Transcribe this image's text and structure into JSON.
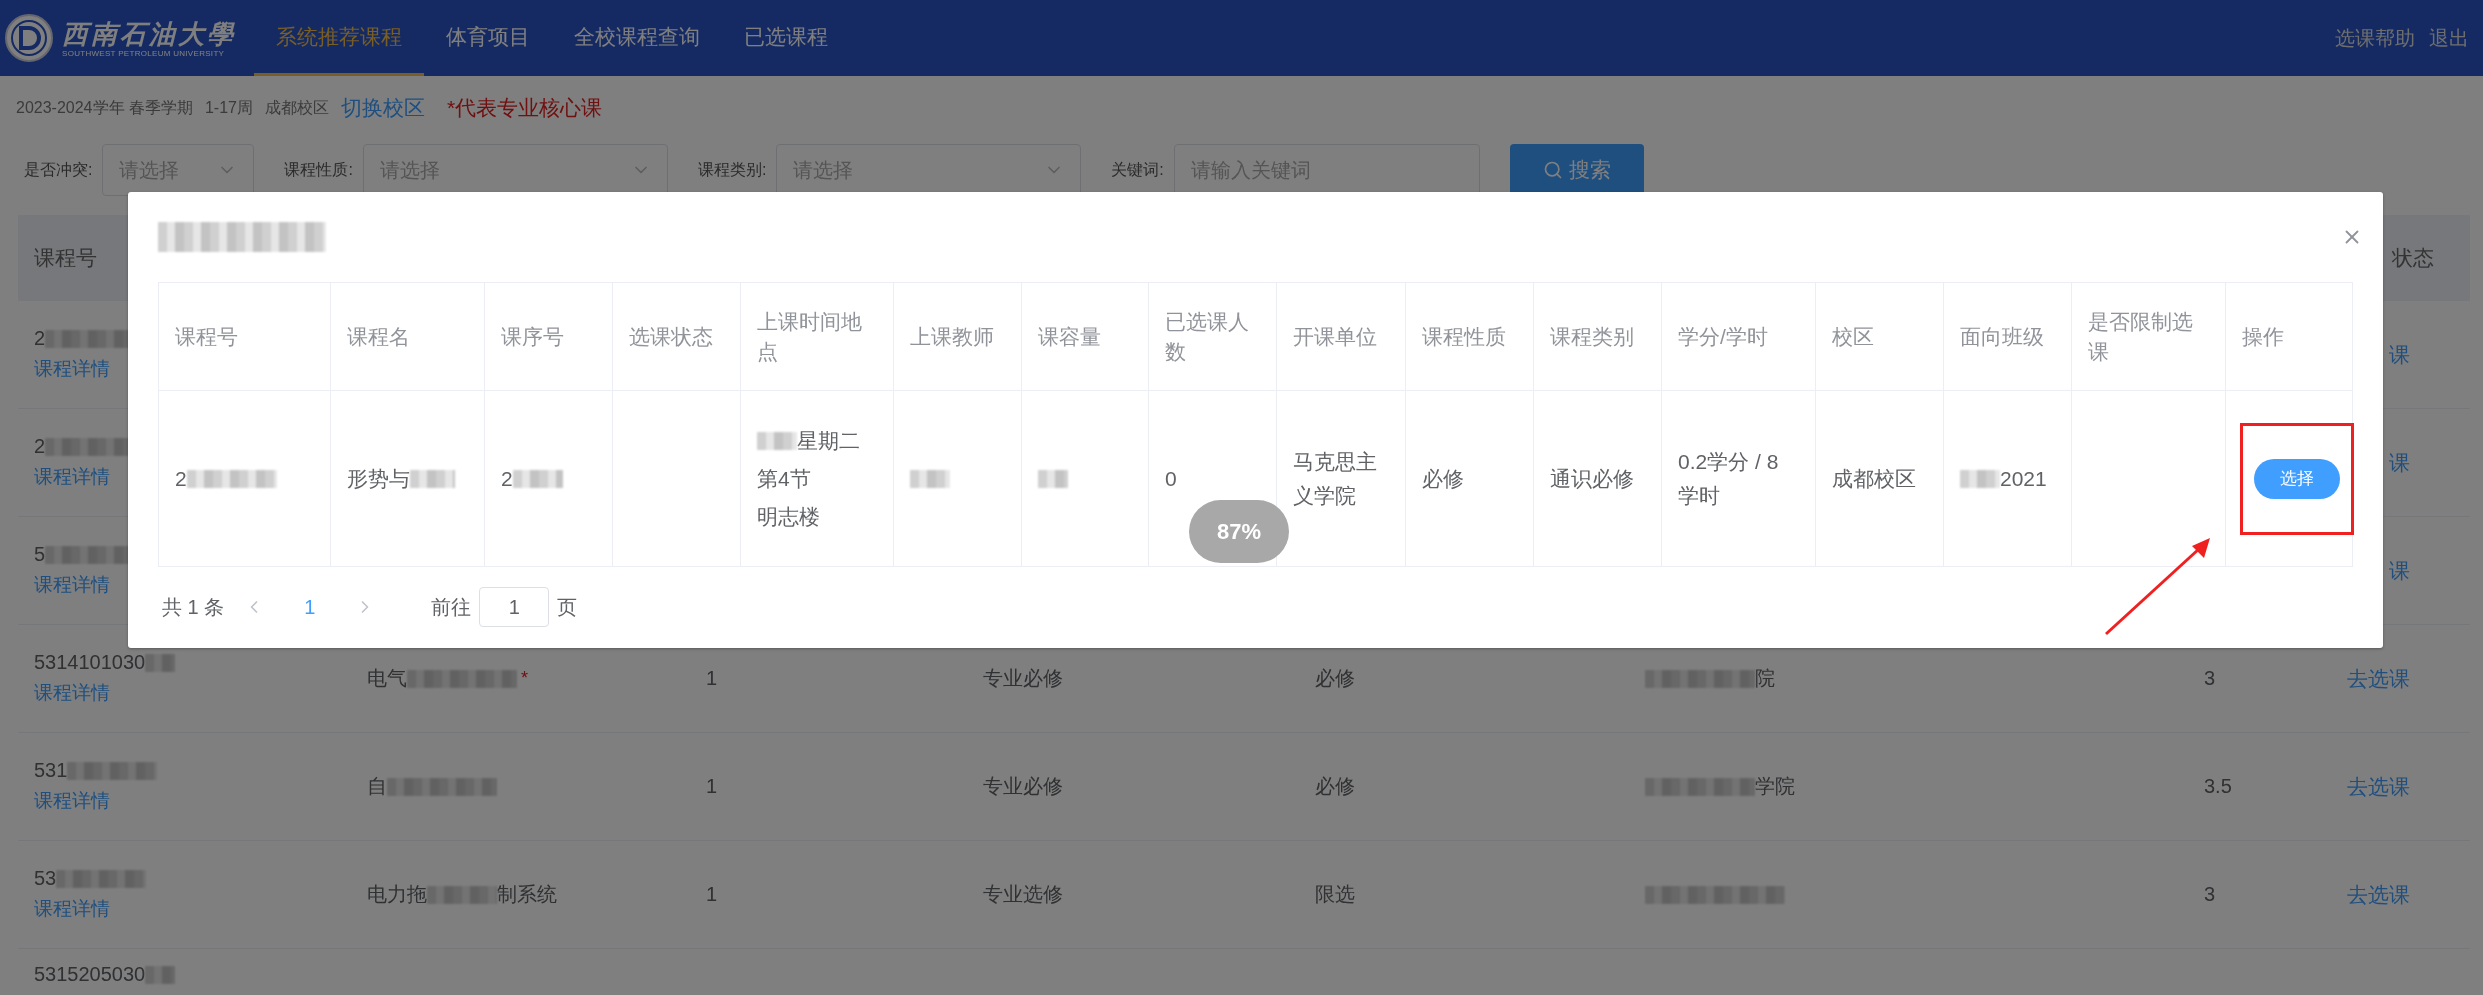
{
  "header": {
    "logo": {
      "name": "西南石油大學",
      "subtitle": "SOUTHWEST PETROLEUM UNIVERSITY"
    },
    "nav": [
      {
        "label": "系统推荐课程",
        "selected": true
      },
      {
        "label": "体育项目",
        "selected": false
      },
      {
        "label": "全校课程查询",
        "selected": false
      },
      {
        "label": "已选课程",
        "selected": false
      }
    ],
    "links": [
      "选课帮助",
      "退出"
    ]
  },
  "info": {
    "term": "2023-2024学年 春季学期",
    "weeks": "1-17周",
    "campus": "成都校区",
    "switch_link": "切换校区",
    "core_note": "*代表专业核心课"
  },
  "filters": [
    {
      "kind": "select",
      "label": "是否冲突:",
      "placeholder": "请选择"
    },
    {
      "kind": "select",
      "label": "课程性质:",
      "placeholder": "请选择"
    },
    {
      "kind": "select",
      "label": "课程类别:",
      "placeholder": "请选择"
    },
    {
      "kind": "input",
      "label": "关键词:",
      "placeholder": "请输入关键词"
    }
  ],
  "search_button": "搜索",
  "course_table": {
    "columns": {
      "first": "课程号",
      "last": "状态"
    },
    "rows": [
      {
        "code": "2",
        "detail_link": "课程详情",
        "action": "课"
      },
      {
        "code": "2",
        "detail_link": "课程详情",
        "action": "课"
      },
      {
        "code": "5",
        "detail_link": "课程详情",
        "action": "课"
      },
      {
        "code": "5314101030",
        "detail_link": "课程详情",
        "name": "电气",
        "core_mark": "*",
        "count": "1",
        "type": "专业必修",
        "nature": "必修",
        "dept": "院",
        "credit": "3",
        "action": "去选课"
      },
      {
        "code": "531",
        "detail_link": "课程详情",
        "name": "自",
        "count": "1",
        "type": "专业必修",
        "nature": "必修",
        "dept": "学院",
        "credit": "3.5",
        "action": "去选课"
      },
      {
        "code": "53",
        "detail_link": "课程详情",
        "name": "电力拖",
        "name_end": "制系统",
        "count": "1",
        "type": "专业选修",
        "nature": "限选",
        "credit": "3",
        "action": "去选课"
      },
      {
        "code": "5315205030"
      }
    ]
  },
  "dialog": {
    "columns": [
      "课程号",
      "课程名",
      "课序号",
      "选课状态",
      "上课时间地点",
      "上课教师",
      "课容量",
      "已选课人数",
      "开课单位",
      "课程性质",
      "课程类别",
      "学分/学时",
      "校区",
      "面向班级",
      "是否限制选课",
      "操作"
    ],
    "cells": [
      {
        "kind": "text",
        "text": "2",
        "blurred": true
      },
      {
        "kind": "text",
        "text": "形势与",
        "blurred": true
      },
      {
        "kind": "text",
        "text": "2",
        "blurred": true
      },
      {
        "kind": "blank"
      },
      {
        "kind": "lines",
        "lines": [
          "星期二",
          "第4节",
          "明志楼"
        ],
        "blurred": true
      },
      {
        "kind": "text",
        "blurred": true
      },
      {
        "kind": "text",
        "blurred": true
      },
      {
        "kind": "text",
        "text": "0",
        "blurred": false
      },
      {
        "kind": "text",
        "text": "马克思主义学院",
        "blurred": false
      },
      {
        "kind": "text",
        "text": "必修",
        "blurred": false
      },
      {
        "kind": "text",
        "text": "通识必修",
        "blurred": false
      },
      {
        "kind": "text",
        "text": "0.2学分 / 8学时",
        "blurred": false
      },
      {
        "kind": "text",
        "text": "成都校区",
        "blurred": false
      },
      {
        "kind": "lines",
        "lines": [
          "2021"
        ],
        "blurred": true
      },
      {
        "kind": "blank"
      },
      {
        "kind": "button",
        "text": "选择",
        "highlighted": true
      }
    ],
    "pagination": {
      "total": "共 1 条",
      "pages": [
        {
          "label": "1",
          "selected": true
        }
      ],
      "goto_label": "前往",
      "goto_value": "1",
      "page_suffix": "页"
    }
  },
  "zoom_indicator": "87%"
}
